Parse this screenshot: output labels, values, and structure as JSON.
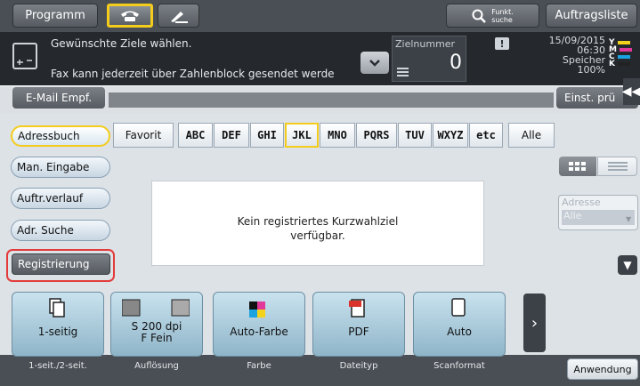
{
  "topbar": {
    "programm_label": "Programm",
    "funkt_label_line1": "Funkt.",
    "funkt_label_line2": "suche",
    "auftragsliste_label": "Auftragsliste"
  },
  "info": {
    "message1": "Gewünschte Ziele wählen.",
    "message2": "Fax kann jederzeit über Zahlenblock gesendet werde",
    "zielnummer_label": "Zielnummer",
    "zielnummer_value": "0",
    "date": "15/09/2015",
    "time": "06:30",
    "speicher_label": "Speicher",
    "speicher_value": "100%",
    "ink": [
      "Y",
      "M",
      "C",
      "K"
    ],
    "ink_colors": [
      "#f3d21b",
      "#e0399a",
      "#1aa3e0",
      "#222222"
    ]
  },
  "email_row": {
    "email_label": "E-Mail Empf.",
    "einst_label": "Einst. prü"
  },
  "left_menu": {
    "adressbuch": "Adressbuch",
    "man_eingabe": "Man. Eingabe",
    "auftr_verlauf": "Auftr.verlauf",
    "adr_suche": "Adr. Suche",
    "registrierung": "Registrierung"
  },
  "tabs": [
    "Favorit",
    "ABC",
    "DEF",
    "GHI",
    "JKL",
    "MNO",
    "PQRS",
    "TUV",
    "WXYZ",
    "etc",
    "Alle"
  ],
  "selected_tab": "JKL",
  "message_box": {
    "line1": "Kein registriertes Kurzwahlziel",
    "line2": "verfügbar."
  },
  "address_filter": {
    "label": "Adresse",
    "value": "Alle"
  },
  "settings": [
    {
      "value": "1-seitig",
      "category": "1-seit./2-seit."
    },
    {
      "value": "S 200 dpi\nF Fein",
      "category": "Auflösung"
    },
    {
      "value": "Auto-Farbe",
      "category": "Farbe"
    },
    {
      "value": "PDF",
      "category": "Dateityp"
    },
    {
      "value": "Auto",
      "category": "Scanformat"
    }
  ],
  "anwendung_label": "Anwendung",
  "colors": {
    "accent_yellow": "#f4cc1c",
    "highlight_red": "#e33b3b"
  }
}
